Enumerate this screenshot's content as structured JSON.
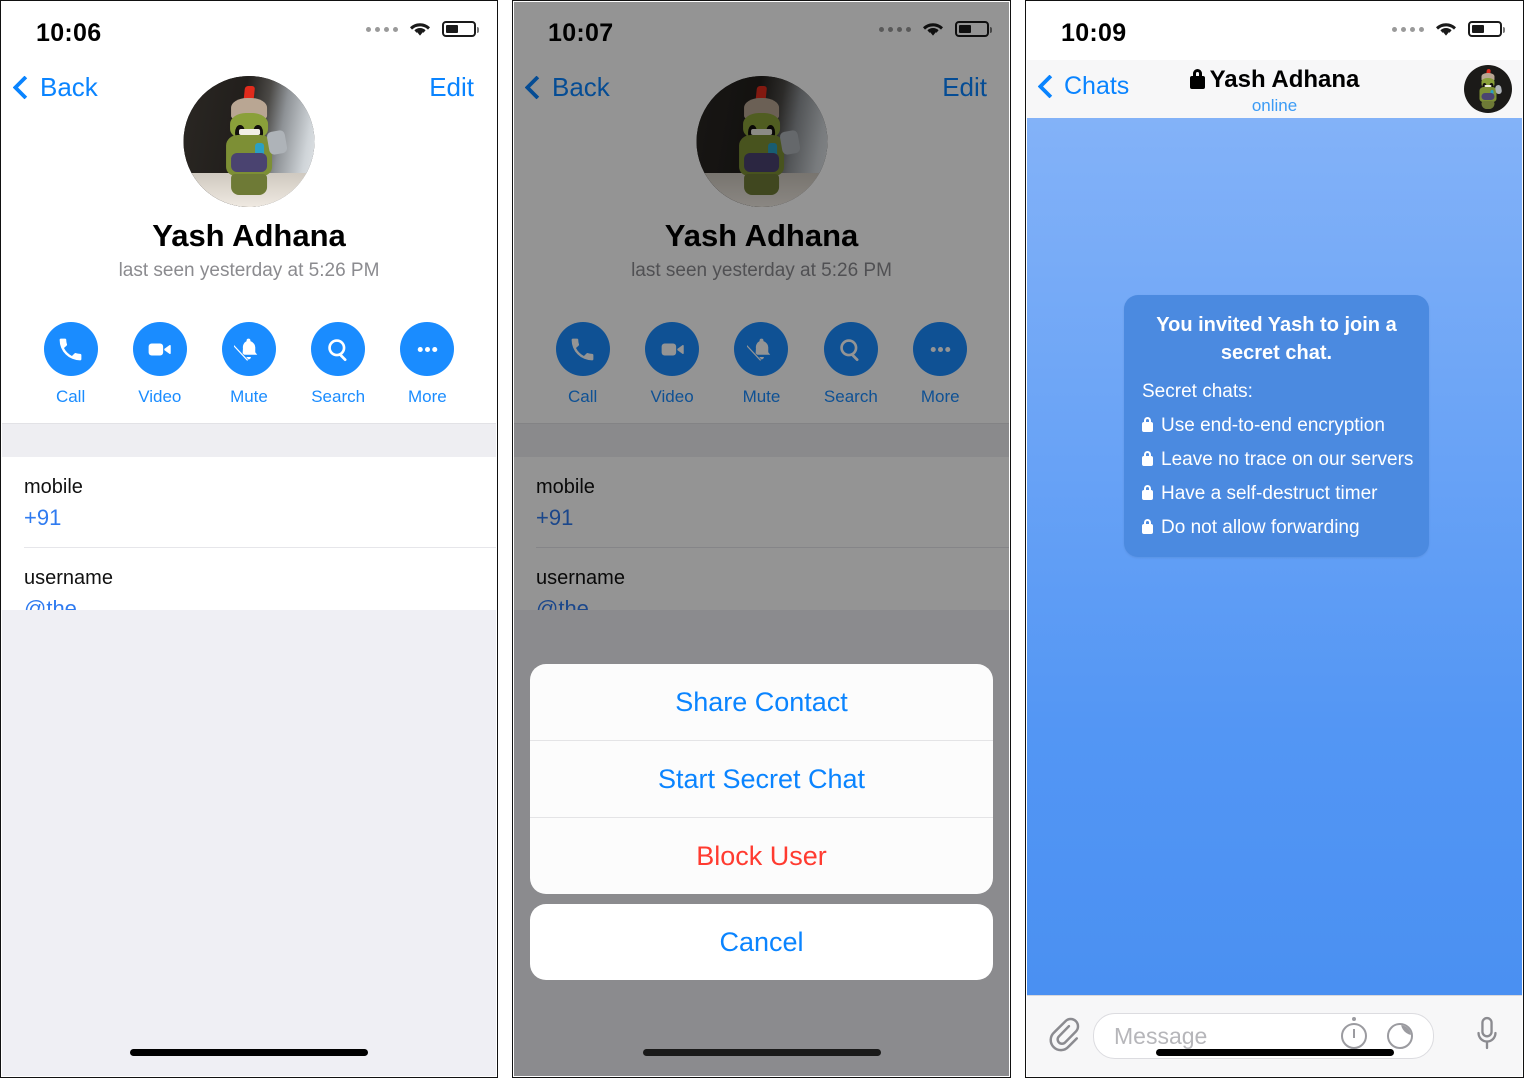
{
  "panels": [
    {
      "id": "profile",
      "statusbar": {
        "time": "10:06",
        "signal_icon": "signal-dots-icon",
        "wifi_icon": "wifi-icon",
        "battery_icon": "battery-icon"
      },
      "nav": {
        "back_label": "Back",
        "edit_label": "Edit"
      },
      "profile": {
        "name": "Yash Adhana",
        "status": "last seen yesterday at 5:26 PM"
      },
      "actions": [
        {
          "label": "Call",
          "icon": "phone-icon"
        },
        {
          "label": "Video",
          "icon": "video-camera-icon"
        },
        {
          "label": "Mute",
          "icon": "bell-slash-icon"
        },
        {
          "label": "Search",
          "icon": "search-icon"
        },
        {
          "label": "More",
          "icon": "ellipsis-icon"
        }
      ],
      "info": [
        {
          "key": "mobile",
          "value": "+91"
        },
        {
          "key": "username",
          "value": "@the"
        }
      ]
    },
    {
      "id": "profile-actionsheet",
      "statusbar": {
        "time": "10:07",
        "signal_icon": "signal-dots-icon",
        "wifi_icon": "wifi-icon",
        "battery_icon": "battery-icon"
      },
      "nav": {
        "back_label": "Back",
        "edit_label": "Edit"
      },
      "profile": {
        "name": "Yash Adhana",
        "status": "last seen yesterday at 5:26 PM"
      },
      "actions": [
        {
          "label": "Call",
          "icon": "phone-icon"
        },
        {
          "label": "Video",
          "icon": "video-camera-icon"
        },
        {
          "label": "Mute",
          "icon": "bell-slash-icon"
        },
        {
          "label": "Search",
          "icon": "search-icon"
        },
        {
          "label": "More",
          "icon": "ellipsis-icon"
        }
      ],
      "info": [
        {
          "key": "mobile",
          "value": "+91"
        },
        {
          "key": "username",
          "value": "@the"
        }
      ],
      "sheet": {
        "items": [
          {
            "label": "Share Contact",
            "style": "default"
          },
          {
            "label": "Start Secret Chat",
            "style": "default"
          },
          {
            "label": "Block User",
            "style": "destructive"
          }
        ],
        "cancel_label": "Cancel"
      }
    },
    {
      "id": "secret-chat",
      "statusbar": {
        "time": "10:09",
        "signal_icon": "signal-dots-icon",
        "wifi_icon": "wifi-icon",
        "battery_icon": "battery-icon"
      },
      "nav": {
        "back_label": "Chats",
        "title": "Yash Adhana",
        "title_lock_icon": "lock-icon",
        "subtitle": "online",
        "avatar": "contact-avatar"
      },
      "service_message": {
        "headline": "You invited Yash to join a secret chat.",
        "subhead": "Secret chats:",
        "bullets": [
          "Use end-to-end encryption",
          "Leave no trace on our servers",
          "Have a self-destruct timer",
          "Do not allow forwarding"
        ],
        "bullet_icon": "lock-icon"
      },
      "composer": {
        "attach_icon": "paperclip-icon",
        "placeholder": "Message",
        "timer_icon": "self-destruct-timer-icon",
        "sticker_icon": "sticker-icon",
        "mic_icon": "microphone-icon"
      }
    }
  ],
  "colors": {
    "accent_blue": "#1a8cff",
    "link_blue": "#0a84ff",
    "destructive_red": "#ff3b30",
    "bubble_blue": "#4b8ae0",
    "chat_bg_top": "#83b2f8",
    "chat_bg_bottom": "#4a90f2",
    "list_gray": "#efeff4"
  }
}
